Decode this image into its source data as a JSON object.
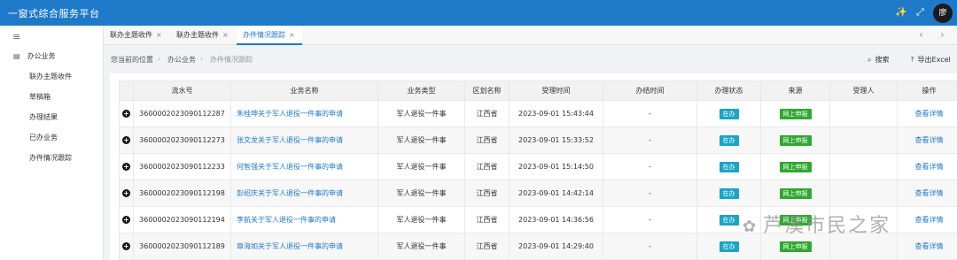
{
  "header": {
    "title": "一窗式综合服务平台",
    "icons": [
      "wand-icon",
      "expand-icon",
      "more-icon"
    ],
    "avatar_text": "廖"
  },
  "sidebar": {
    "toggle_icon": "menu-icon",
    "group_label": "办公业务",
    "items": [
      {
        "label": "联办主题收件"
      },
      {
        "label": "草稿箱"
      },
      {
        "label": "办理结果"
      },
      {
        "label": "已办业务"
      },
      {
        "label": "办件情况跟踪"
      }
    ]
  },
  "tabs": [
    {
      "label": "联办主题收件",
      "active": false
    },
    {
      "label": "联办主题收件",
      "active": false
    },
    {
      "label": "办件情况跟踪",
      "active": true
    }
  ],
  "breadcrumb": {
    "prefix": "您当前的位置",
    "items": [
      "办公业务",
      "办件情况跟踪"
    ]
  },
  "actions": {
    "search": "搜索",
    "export": "导出Excel"
  },
  "table": {
    "columns": [
      "",
      "流水号",
      "业务名称",
      "业务类型",
      "区划名称",
      "受理时间",
      "办结时间",
      "办理状态",
      "来源",
      "受理人",
      "操作"
    ],
    "rows": [
      {
        "serial": "3600002023090112287",
        "name": "朱桂坤关于军人退役一件事的申请",
        "type": "军人退役一件事",
        "region": "江西省",
        "accepted": "2023-09-01 15:43:44",
        "finished": "-",
        "status": "在办",
        "source": "网上申报",
        "handler": "",
        "op": "查看详情"
      },
      {
        "serial": "3600002023090112273",
        "name": "张文龙关于军人退役一件事的申请",
        "type": "军人退役一件事",
        "region": "江西省",
        "accepted": "2023-09-01 15:33:52",
        "finished": "-",
        "status": "在办",
        "source": "网上申报",
        "handler": "",
        "op": "查看详情"
      },
      {
        "serial": "3600002023090112233",
        "name": "何智强关于军人退役一件事的申请",
        "type": "军人退役一件事",
        "region": "江西省",
        "accepted": "2023-09-01 15:14:50",
        "finished": "-",
        "status": "在办",
        "source": "网上申报",
        "handler": "",
        "op": "查看详情"
      },
      {
        "serial": "3600002023090112198",
        "name": "彭绍庆关于军人退役一件事的申请",
        "type": "军人退役一件事",
        "region": "江西省",
        "accepted": "2023-09-01 14:42:14",
        "finished": "-",
        "status": "在办",
        "source": "网上申报",
        "handler": "",
        "op": "查看详情"
      },
      {
        "serial": "3600002023090112194",
        "name": "李航关于军人退役一件事的申请",
        "type": "军人退役一件事",
        "region": "江西省",
        "accepted": "2023-09-01 14:36:56",
        "finished": "-",
        "status": "在办",
        "source": "网上申报",
        "handler": "",
        "op": "查看详情"
      },
      {
        "serial": "3600002023090112189",
        "name": "章海如关于军人退役一件事的申请",
        "type": "军人退役一件事",
        "region": "江西省",
        "accepted": "2023-09-01 14:29:40",
        "finished": "-",
        "status": "在办",
        "source": "网上申报",
        "handler": "",
        "op": "查看详情"
      }
    ]
  },
  "watermark": "芦溪市民之家"
}
